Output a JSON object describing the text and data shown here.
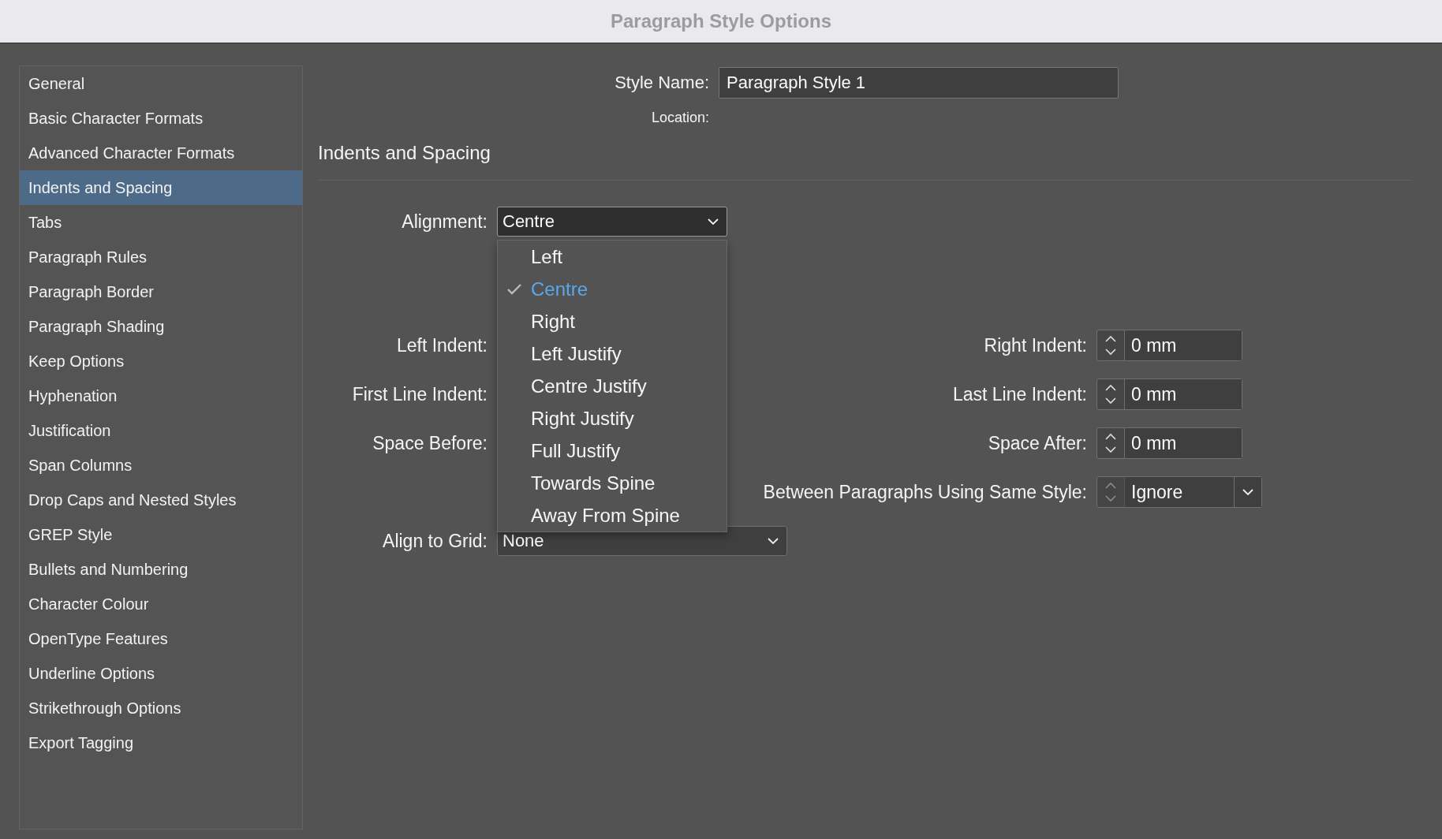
{
  "window": {
    "title": "Paragraph Style Options"
  },
  "sidebar": {
    "items": [
      {
        "label": "General",
        "selected": false
      },
      {
        "label": "Basic Character Formats",
        "selected": false
      },
      {
        "label": "Advanced Character Formats",
        "selected": false
      },
      {
        "label": "Indents and Spacing",
        "selected": true
      },
      {
        "label": "Tabs",
        "selected": false
      },
      {
        "label": "Paragraph Rules",
        "selected": false
      },
      {
        "label": "Paragraph Border",
        "selected": false
      },
      {
        "label": "Paragraph Shading",
        "selected": false
      },
      {
        "label": "Keep Options",
        "selected": false
      },
      {
        "label": "Hyphenation",
        "selected": false
      },
      {
        "label": "Justification",
        "selected": false
      },
      {
        "label": "Span Columns",
        "selected": false
      },
      {
        "label": "Drop Caps and Nested Styles",
        "selected": false
      },
      {
        "label": "GREP Style",
        "selected": false
      },
      {
        "label": "Bullets and Numbering",
        "selected": false
      },
      {
        "label": "Character Colour",
        "selected": false
      },
      {
        "label": "OpenType Features",
        "selected": false
      },
      {
        "label": "Underline Options",
        "selected": false
      },
      {
        "label": "Strikethrough Options",
        "selected": false
      },
      {
        "label": "Export Tagging",
        "selected": false
      }
    ]
  },
  "style_name": {
    "label": "Style Name:",
    "value": "Paragraph Style 1"
  },
  "location": {
    "label": "Location:"
  },
  "section_title": "Indents and Spacing",
  "alignment": {
    "label": "Alignment:",
    "value": "Centre",
    "expanded": true,
    "options": [
      {
        "label": "Left",
        "selected": false
      },
      {
        "label": "Centre",
        "selected": true
      },
      {
        "label": "Right",
        "selected": false
      },
      {
        "label": "Left Justify",
        "selected": false
      },
      {
        "label": "Centre Justify",
        "selected": false
      },
      {
        "label": "Right Justify",
        "selected": false
      },
      {
        "label": "Full Justify",
        "selected": false
      },
      {
        "label": "Towards Spine",
        "selected": false
      },
      {
        "label": "Away From Spine",
        "selected": false
      }
    ]
  },
  "rows": [
    {
      "left": {
        "label": "Left Indent:"
      },
      "right": {
        "label": "Right Indent:",
        "value": "0 mm",
        "kind": "spinner",
        "disabled": false
      }
    },
    {
      "left": {
        "label": "First Line Indent:"
      },
      "right": {
        "label": "Last Line Indent:",
        "value": "0 mm",
        "kind": "spinner",
        "disabled": false
      }
    },
    {
      "left": {
        "label": "Space Before:"
      },
      "right": {
        "label": "Space After:",
        "value": "0 mm",
        "kind": "spinner",
        "disabled": false
      }
    },
    {
      "right": {
        "label": "Between Paragraphs Using Same Style:",
        "value": "Ignore",
        "kind": "combo",
        "disabled": true
      }
    }
  ],
  "align_to_grid": {
    "label": "Align to Grid:",
    "value": "None"
  }
}
